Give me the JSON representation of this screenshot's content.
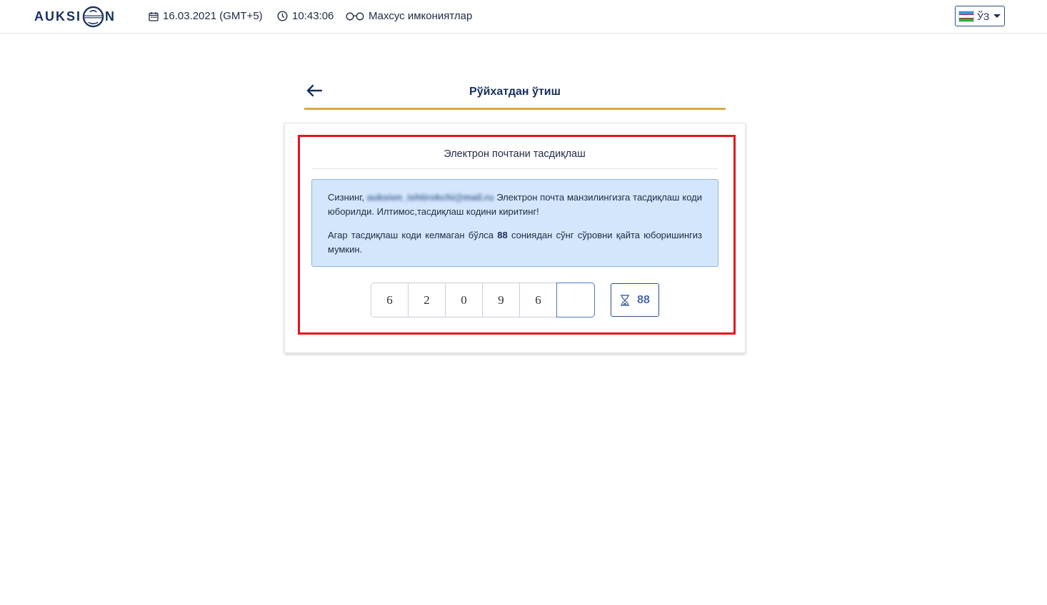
{
  "header": {
    "logo_text_left": "AUKSI",
    "logo_text_right": "N",
    "date": "16.03.2021 (GMT+5)",
    "time": "10:43:06",
    "accessibility_label": "Махсус имкониятлар",
    "language": "ЎЗ"
  },
  "page": {
    "title": "Рўйхатдан ўтиш"
  },
  "card": {
    "title": "Электрон почтани тасдиқлаш",
    "message_prefix": "Сизнинг, ",
    "email": "auksion_ishtirokchi@mail.ru",
    "message_suffix": " Электрон почта манзилингизга тасдиқлаш коди юборилди. Илтимос,тасдиқлаш кодини киритинг!",
    "resend_prefix": "Агар тасдиқлаш коди келмаган бўлса ",
    "resend_seconds": "88",
    "resend_suffix": " сониядан сўнг сўровни қайта юборишингиз мумкин."
  },
  "otp": {
    "digits": [
      "6",
      "2",
      "0",
      "9",
      "6",
      ""
    ]
  },
  "timer": {
    "value": "88",
    "icon": "hourglass-icon"
  },
  "colors": {
    "brand": "#17305f",
    "accent_gold": "#d4ac45",
    "highlight_red": "#e8121a",
    "info_bg": "#d3e6fb"
  }
}
